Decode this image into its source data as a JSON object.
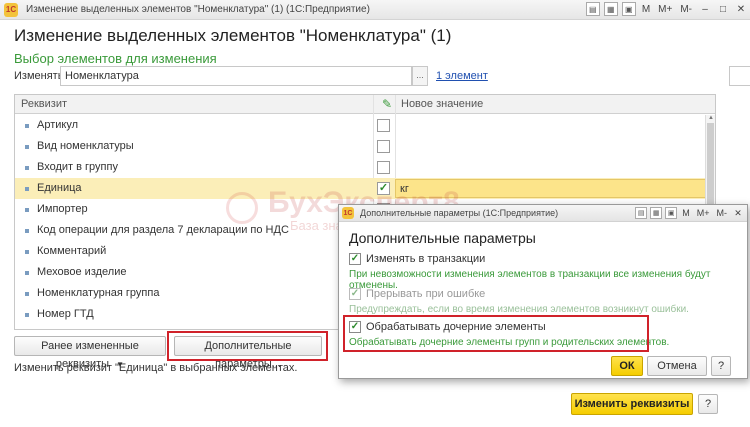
{
  "window": {
    "title": "Изменение выделенных элементов \"Номенклатура\" (1) (1С:Предприятие)",
    "logo_text": "1С",
    "toolbar": {
      "m_label": "M",
      "m_plus_label": "M+",
      "m_minus_label": "M-"
    }
  },
  "main": {
    "title": "Изменение выделенных элементов \"Номенклатура\" (1)",
    "subtitle": "Выбор элементов для изменения",
    "change_label": "Изменять:",
    "change_value": "Номенклатура",
    "elements_link": "1 элемент",
    "table": {
      "col_attribute": "Реквизит",
      "col_new_value": "Новое значение",
      "rows": [
        {
          "name": "Артикул",
          "checked": false,
          "value": ""
        },
        {
          "name": "Вид номенклатуры",
          "checked": false,
          "value": ""
        },
        {
          "name": "Входит в группу",
          "checked": false,
          "value": ""
        },
        {
          "name": "Единица",
          "checked": true,
          "value": "кг",
          "selected": true
        },
        {
          "name": "Импортер",
          "checked": false,
          "value": ""
        },
        {
          "name": "Код операции для раздела 7 декларации по НДС",
          "checked": false,
          "value": ""
        },
        {
          "name": "Комментарий",
          "checked": false,
          "value": ""
        },
        {
          "name": "Меховое изделие",
          "checked": false,
          "value": ""
        },
        {
          "name": "Номенклатурная группа",
          "checked": false,
          "value": ""
        },
        {
          "name": "Номер ГТД",
          "checked": false,
          "value": ""
        }
      ]
    },
    "prev_button": "Ранее измененные реквизиты",
    "params_button": "Дополнительные параметры...",
    "hint": "Изменить реквизит \"Единица\" в выбранных элементах.",
    "apply_button": "Изменить реквизиты",
    "help_button": "?"
  },
  "watermark": {
    "text": "БухЭксперт8",
    "sub": "База знаний"
  },
  "dialog": {
    "title": "Дополнительные параметры (1С:Предприятие)",
    "heading": "Дополнительные параметры",
    "options": [
      {
        "label": "Изменять в транзакции",
        "checked": true,
        "disabled": false,
        "desc": "При невозможности изменения элементов в транзакции все изменения будут отменены."
      },
      {
        "label": "Прерывать при ошибке",
        "checked": true,
        "disabled": true,
        "desc": "Предупреждать, если во время изменения элементов возникнут ошибки."
      },
      {
        "label": "Обрабатывать дочерние элементы",
        "checked": true,
        "disabled": false,
        "desc": "Обрабатывать дочерние элементы групп и родительских элементов."
      }
    ],
    "ok_button": "ОК",
    "cancel_button": "Отмена",
    "help_button": "?"
  }
}
